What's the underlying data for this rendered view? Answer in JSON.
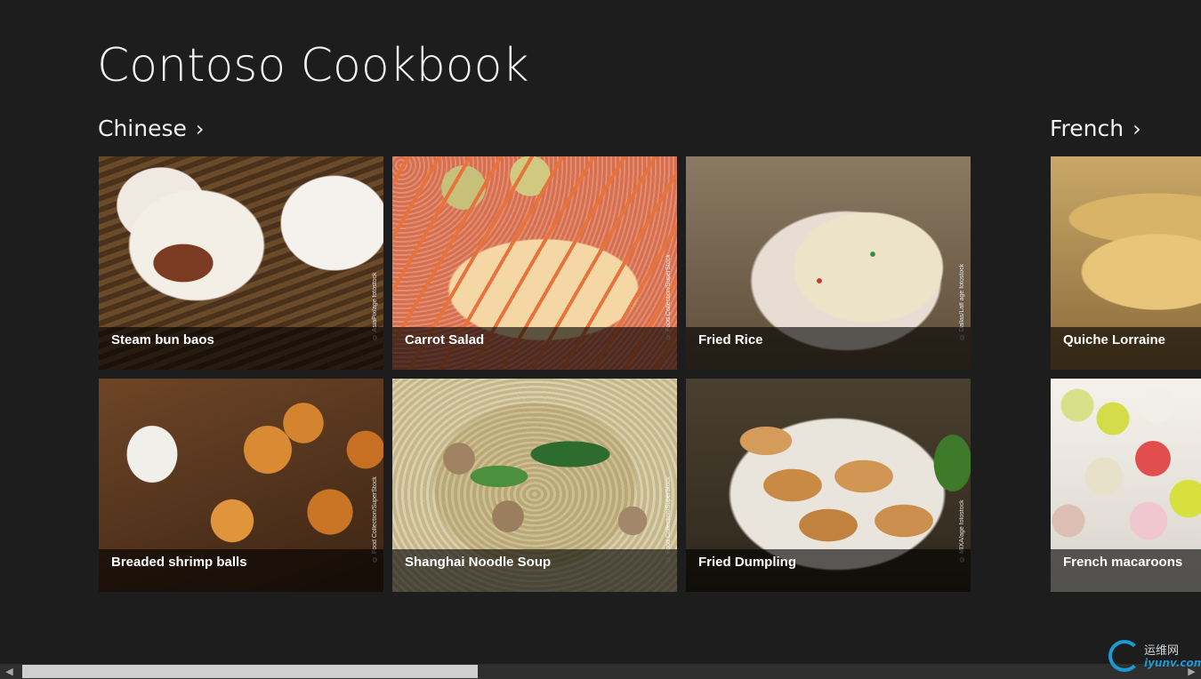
{
  "app": {
    "title": "Contoso Cookbook"
  },
  "groups": [
    {
      "title": "Chinese",
      "chevron": "›",
      "recipes": [
        {
          "name": "Steam bun baos",
          "credit": "© AsiaPix/age fotostock"
        },
        {
          "name": "Carrot Salad",
          "credit": "© Food Collection/SuperStock"
        },
        {
          "name": "Fried Rice",
          "credit": "© Dallas/Lafl age fotostock"
        },
        {
          "name": "Breaded shrimp balls",
          "credit": "© Food Collection/SuperStock"
        },
        {
          "name": "Shanghai Noodle Soup",
          "credit": "© Food Collection/SuperStock"
        },
        {
          "name": "Fried Dumpling",
          "credit": "© MIXA/age fotostock"
        }
      ]
    },
    {
      "title": "French",
      "chevron": "›",
      "recipes": [
        {
          "name": "Quiche Lorraine"
        },
        {
          "name": "French macaroons"
        }
      ]
    }
  ],
  "scrollbar": {
    "left_arrow": "◀",
    "right_arrow": "▶"
  },
  "watermark": {
    "cn": "运维网",
    "url": "iyunv.com"
  }
}
